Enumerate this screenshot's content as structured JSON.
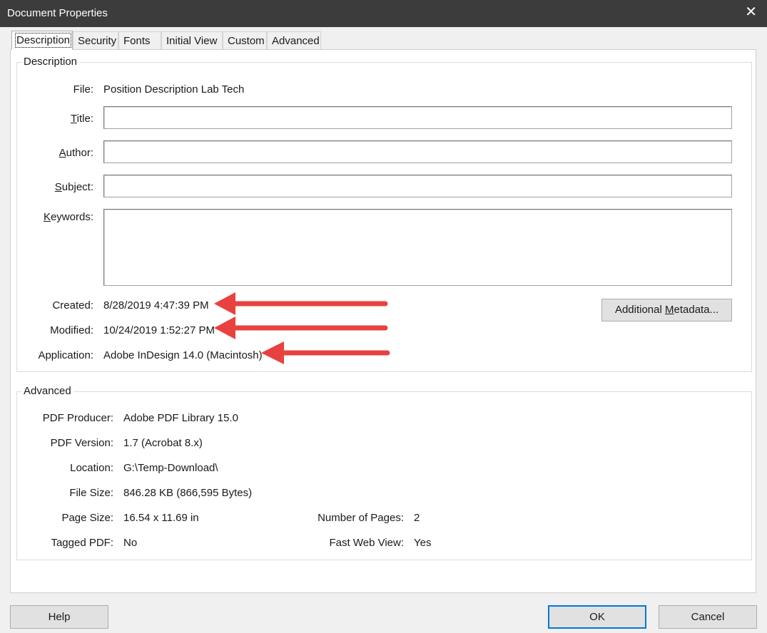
{
  "window": {
    "title": "Document Properties",
    "close_glyph": "✕"
  },
  "tabs": [
    {
      "label": "Description"
    },
    {
      "label": "Security"
    },
    {
      "label": "Fonts"
    },
    {
      "label": "Initial View"
    },
    {
      "label": "Custom"
    },
    {
      "label": "Advanced"
    }
  ],
  "description": {
    "group_label": "Description",
    "file_label": "File:",
    "file_value": "Position Description Lab Tech",
    "title_label_u": "T",
    "title_label_rest": "itle:",
    "title_value": "",
    "author_label_u": "A",
    "author_label_rest": "uthor:",
    "author_value": "",
    "subject_label_u": "S",
    "subject_label_rest": "ubject:",
    "subject_value": "",
    "keywords_label_u": "K",
    "keywords_label_rest": "eywords:",
    "keywords_value": "",
    "created_label": "Created:",
    "created_value": "8/28/2019 4:47:39 PM",
    "modified_label": "Modified:",
    "modified_value": "10/24/2019 1:52:27 PM",
    "application_label": "Application:",
    "application_value": "Adobe InDesign 14.0 (Macintosh)",
    "metadata_button_pre": "Additional ",
    "metadata_button_u": "M",
    "metadata_button_post": "etadata...",
    "arrow_color": "#e8413f"
  },
  "advanced": {
    "group_label": "Advanced",
    "pdf_producer_label": "PDF Producer:",
    "pdf_producer_value": "Adobe PDF Library 15.0",
    "pdf_version_label": "PDF Version:",
    "pdf_version_value": "1.7 (Acrobat 8.x)",
    "location_label": "Location:",
    "location_value": "G:\\Temp-Download\\",
    "file_size_label": "File Size:",
    "file_size_value": "846.28 KB (866,595 Bytes)",
    "page_size_label": "Page Size:",
    "page_size_value": "16.54 x 11.69 in",
    "num_pages_label": "Number of Pages:",
    "num_pages_value": "2",
    "tagged_pdf_label": "Tagged PDF:",
    "tagged_pdf_value": "No",
    "fast_web_view_label": "Fast Web View:",
    "fast_web_view_value": "Yes"
  },
  "buttons": {
    "help": "Help",
    "ok": "OK",
    "cancel": "Cancel"
  }
}
